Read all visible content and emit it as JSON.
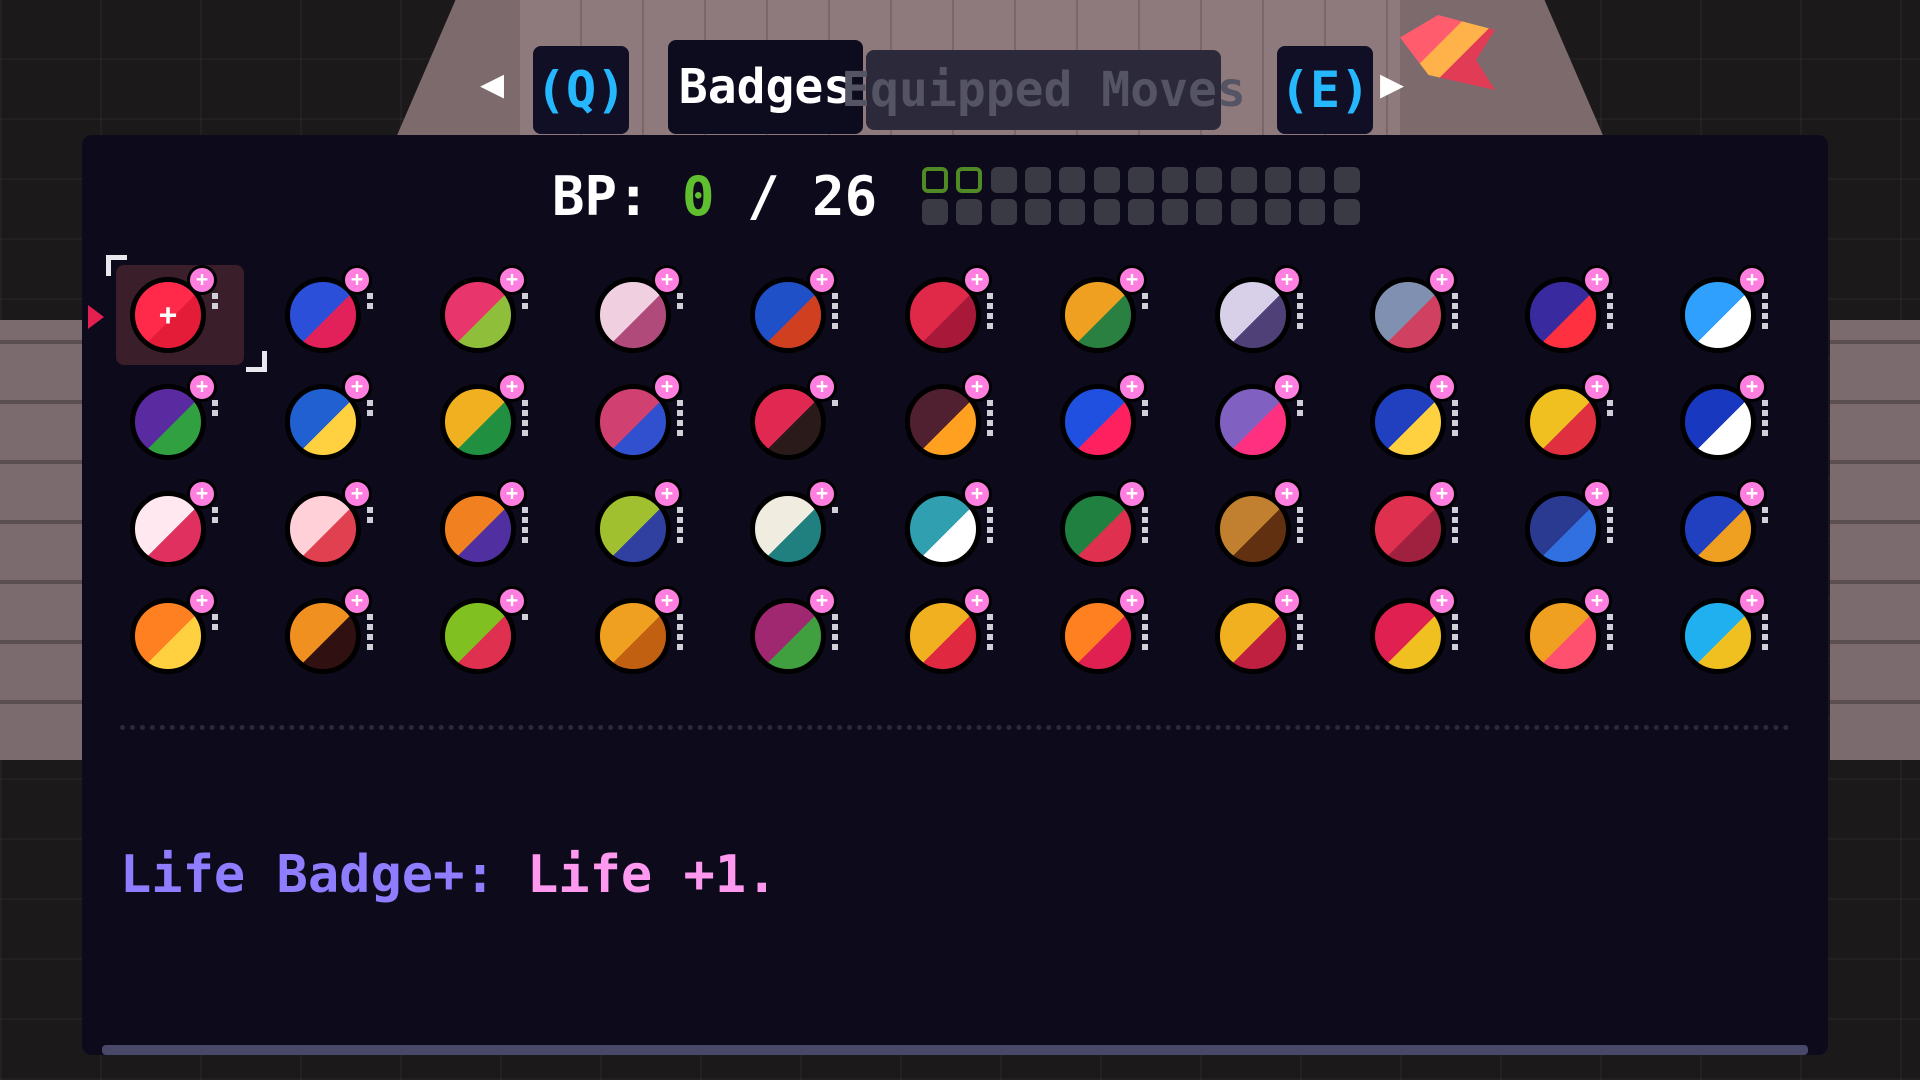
{
  "tabs": {
    "left_key": "(Q)",
    "right_key": "(E)",
    "left_arrow": "◀",
    "right_arrow": "▶",
    "active": "Badges",
    "inactive": "Equipped Moves"
  },
  "bp": {
    "prefix": "BP: ",
    "used": "0",
    "separator": " / ",
    "total": "26",
    "meter_filled": 2,
    "meter_slots": 26
  },
  "badges": [
    {
      "name": "life-badge-plus",
      "colors": [
        "#ff2a4a",
        "#e51c38"
      ],
      "glyph": "+",
      "cost": 2,
      "selected": true
    },
    {
      "name": "badge-2",
      "colors": [
        "#2b4fd8",
        "#e2205a"
      ],
      "glyph": "",
      "cost": 2
    },
    {
      "name": "badge-3",
      "colors": [
        "#e8356c",
        "#8fbf3a"
      ],
      "glyph": "",
      "cost": 2
    },
    {
      "name": "badge-4",
      "colors": [
        "#f0d0e0",
        "#b04a7a"
      ],
      "glyph": "",
      "cost": 2
    },
    {
      "name": "badge-5",
      "colors": [
        "#2050c8",
        "#d04020"
      ],
      "glyph": "",
      "cost": 4
    },
    {
      "name": "badge-6",
      "colors": [
        "#e02848",
        "#a81838"
      ],
      "glyph": "",
      "cost": 4
    },
    {
      "name": "badge-7",
      "colors": [
        "#f0a020",
        "#2a8040"
      ],
      "glyph": "",
      "cost": 2
    },
    {
      "name": "badge-8",
      "colors": [
        "#d8d0e8",
        "#504078"
      ],
      "glyph": "",
      "cost": 4
    },
    {
      "name": "badge-9",
      "colors": [
        "#8090b0",
        "#d04060"
      ],
      "glyph": "",
      "cost": 4
    },
    {
      "name": "badge-10",
      "colors": [
        "#3a2aa0",
        "#ff3040"
      ],
      "glyph": "",
      "cost": 4
    },
    {
      "name": "badge-11",
      "colors": [
        "#30a0ff",
        "#ffffff"
      ],
      "glyph": "",
      "cost": 4
    },
    {
      "name": "badge-12",
      "colors": [
        "#5a2aa0",
        "#30a040"
      ],
      "glyph": "",
      "cost": 2
    },
    {
      "name": "badge-13",
      "colors": [
        "#2060d0",
        "#ffd040"
      ],
      "glyph": "",
      "cost": 2
    },
    {
      "name": "badge-14",
      "colors": [
        "#f0b020",
        "#209040"
      ],
      "glyph": "",
      "cost": 4
    },
    {
      "name": "badge-15",
      "colors": [
        "#d04070",
        "#3050d0"
      ],
      "glyph": "",
      "cost": 4
    },
    {
      "name": "badge-16",
      "colors": [
        "#e02850",
        "#2a1a1a"
      ],
      "glyph": "",
      "cost": 1
    },
    {
      "name": "badge-17",
      "colors": [
        "#502030",
        "#ffa020"
      ],
      "glyph": "",
      "cost": 4
    },
    {
      "name": "badge-18",
      "colors": [
        "#2050e0",
        "#ff2060"
      ],
      "glyph": "",
      "cost": 2
    },
    {
      "name": "badge-19",
      "colors": [
        "#8060c0",
        "#ff3080"
      ],
      "glyph": "",
      "cost": 2
    },
    {
      "name": "badge-20",
      "colors": [
        "#2040c0",
        "#ffd040"
      ],
      "glyph": "",
      "cost": 4
    },
    {
      "name": "badge-21",
      "colors": [
        "#f0c020",
        "#e03040"
      ],
      "glyph": "",
      "cost": 2
    },
    {
      "name": "badge-22",
      "colors": [
        "#1838c0",
        "#ffffff"
      ],
      "glyph": "",
      "cost": 4
    },
    {
      "name": "badge-23",
      "colors": [
        "#ffe8f0",
        "#e03060"
      ],
      "glyph": "",
      "cost": 2
    },
    {
      "name": "badge-24",
      "colors": [
        "#ffd0d8",
        "#e04050"
      ],
      "glyph": "",
      "cost": 2
    },
    {
      "name": "badge-25",
      "colors": [
        "#f08020",
        "#5030a0"
      ],
      "glyph": "",
      "cost": 4
    },
    {
      "name": "badge-26",
      "colors": [
        "#a0c030",
        "#3040a0"
      ],
      "glyph": "",
      "cost": 4
    },
    {
      "name": "badge-27",
      "colors": [
        "#f0ece0",
        "#208080"
      ],
      "glyph": "",
      "cost": 1
    },
    {
      "name": "badge-28",
      "colors": [
        "#30a0b0",
        "#ffffff"
      ],
      "glyph": "",
      "cost": 4
    },
    {
      "name": "badge-29",
      "colors": [
        "#208040",
        "#e03050"
      ],
      "glyph": "",
      "cost": 4
    },
    {
      "name": "badge-30",
      "colors": [
        "#c08030",
        "#603010"
      ],
      "glyph": "",
      "cost": 4
    },
    {
      "name": "badge-31",
      "colors": [
        "#e03050",
        "#a02040"
      ],
      "glyph": "",
      "cost": 4
    },
    {
      "name": "badge-32",
      "colors": [
        "#2a3a90",
        "#3070e0"
      ],
      "glyph": "",
      "cost": 4
    },
    {
      "name": "badge-33",
      "colors": [
        "#2040c0",
        "#f0a020"
      ],
      "glyph": "",
      "cost": 2
    },
    {
      "name": "badge-34",
      "colors": [
        "#ff8020",
        "#ffd040"
      ],
      "glyph": "",
      "cost": 2
    },
    {
      "name": "badge-35",
      "colors": [
        "#f09020",
        "#301010"
      ],
      "glyph": "",
      "cost": 4
    },
    {
      "name": "badge-36",
      "colors": [
        "#80c020",
        "#e03050"
      ],
      "glyph": "",
      "cost": 1
    },
    {
      "name": "badge-37",
      "colors": [
        "#f0a020",
        "#c06010"
      ],
      "glyph": "",
      "cost": 4
    },
    {
      "name": "badge-38",
      "colors": [
        "#a02870",
        "#40a040"
      ],
      "glyph": "",
      "cost": 4
    },
    {
      "name": "badge-39",
      "colors": [
        "#f0b020",
        "#e02840"
      ],
      "glyph": "",
      "cost": 4
    },
    {
      "name": "badge-40",
      "colors": [
        "#ff8020",
        "#e02050"
      ],
      "glyph": "",
      "cost": 4
    },
    {
      "name": "badge-41",
      "colors": [
        "#f0b020",
        "#c02040"
      ],
      "glyph": "",
      "cost": 4
    },
    {
      "name": "badge-42",
      "colors": [
        "#e02050",
        "#f0c020"
      ],
      "glyph": "",
      "cost": 4
    },
    {
      "name": "badge-43",
      "colors": [
        "#f0a020",
        "#ff5070"
      ],
      "glyph": "",
      "cost": 4
    },
    {
      "name": "badge-44",
      "colors": [
        "#20b0f0",
        "#f0c020"
      ],
      "glyph": "",
      "cost": 4
    }
  ],
  "description": {
    "name": "Life Badge+: ",
    "effect": "Life +1."
  }
}
